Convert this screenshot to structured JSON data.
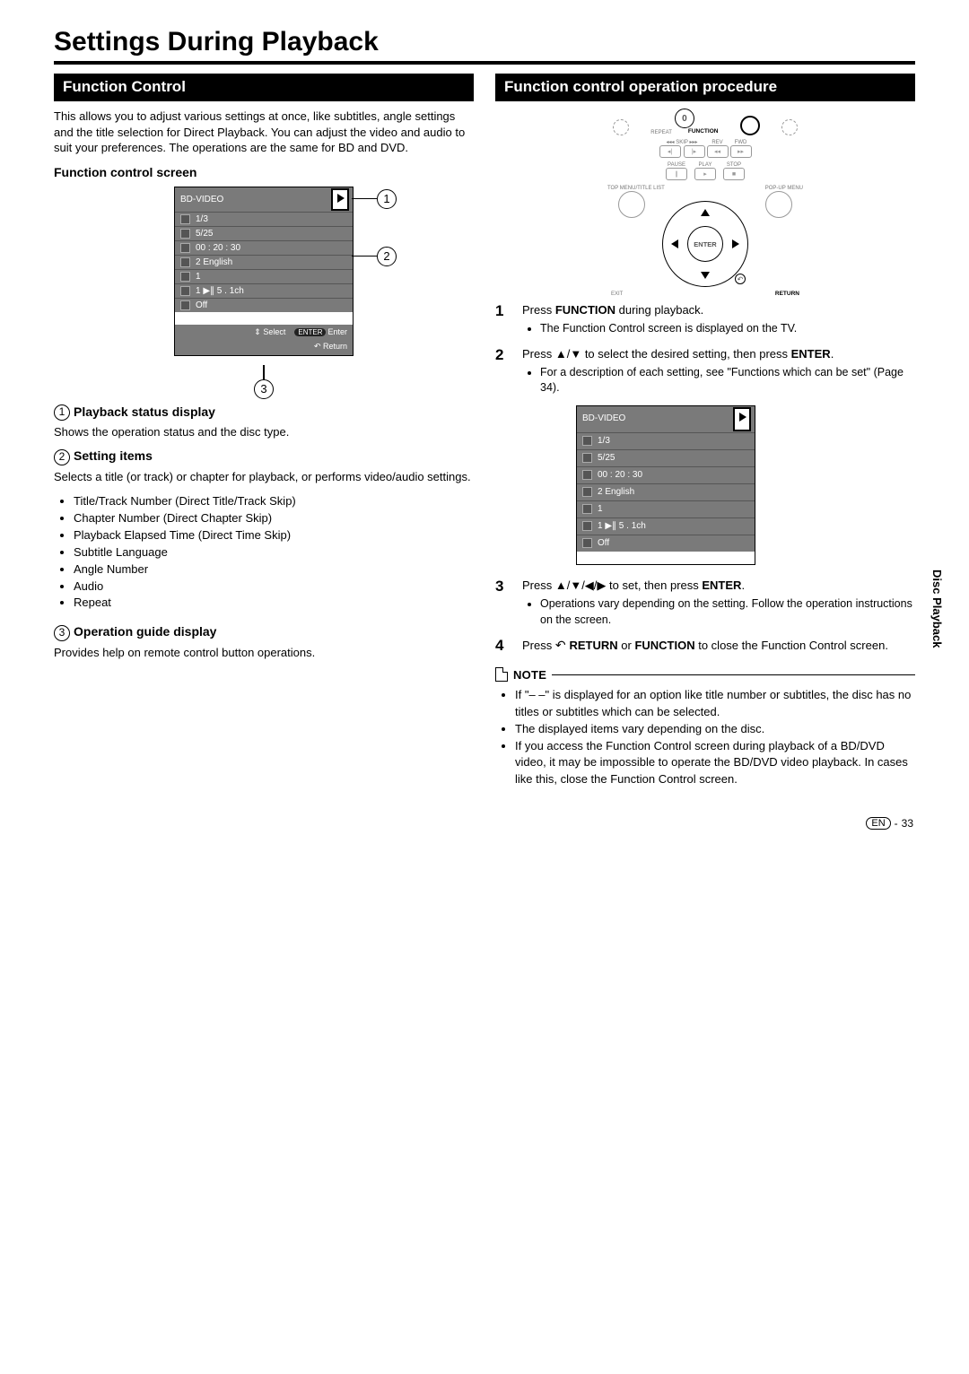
{
  "page": {
    "title": "Settings During Playback",
    "sideTab": "Disc Playback",
    "footerLang": "EN",
    "footerPage": "33"
  },
  "left": {
    "sectionTitle": "Function Control",
    "intro": "This allows you to adjust various settings at once, like subtitles, angle settings and the title selection for Direct Playback. You can adjust the video and audio to suit your preferences. The operations are the same for BD and DVD.",
    "screenLabel": "Function control screen",
    "screen": {
      "header": "BD-VIDEO",
      "rows": [
        "1/3",
        "5/25",
        "00 : 20 : 30",
        "2 English",
        "1",
        "1   ▶∥   5 . 1ch",
        "Off"
      ],
      "guideSelect": "Select",
      "guideEnterPill": "ENTER",
      "guideEnter": "Enter",
      "guideReturn": "Return"
    },
    "item1": {
      "num": "1",
      "title": "Playback status display",
      "text": "Shows the operation status and the disc type."
    },
    "item2": {
      "num": "2",
      "title": "Setting items",
      "text": "Selects a title (or track) or chapter for playback, or performs video/audio settings.",
      "bullets": [
        "Title/Track Number (Direct Title/Track Skip)",
        "Chapter Number (Direct Chapter Skip)",
        "Playback Elapsed Time (Direct Time Skip)",
        "Subtitle Language",
        "Angle Number",
        "Audio",
        "Repeat"
      ]
    },
    "item3": {
      "num": "3",
      "title": "Operation guide display",
      "text": "Provides help on remote control button operations."
    }
  },
  "right": {
    "sectionTitle": "Function control operation procedure",
    "remote": {
      "zero": "0",
      "repeat": "REPEAT",
      "function": "FUNCTION",
      "skip": "SKIP",
      "rev": "REV",
      "fwd": "FWD",
      "pause": "PAUSE",
      "play": "PLAY",
      "stop": "STOP",
      "topMenu": "TOP MENU/TITLE LIST",
      "popup": "POP-UP MENU",
      "enter": "ENTER",
      "exit": "EXIT",
      "return": "RETURN"
    },
    "steps": {
      "s1a": "Press ",
      "s1b": "FUNCTION",
      "s1c": " during playback.",
      "s1sub": "The Function Control screen is displayed on the TV.",
      "s2a": "Press ",
      "s2arrows": "▲/▼",
      "s2b": " to select the desired setting, then press ",
      "s2enter": "ENTER",
      "s2c": ".",
      "s2sub": "For a description of each setting, see \"Functions which can be set\" (Page 34).",
      "s3a": "Press ",
      "s3arrows": "▲/▼/◀/▶",
      "s3b": " to set, then press ",
      "s3enter": "ENTER",
      "s3c": ".",
      "s3sub": "Operations vary depending on the setting. Follow the operation instructions on the screen.",
      "s4a": "Press ",
      "s4ret": "RETURN",
      "s4b": " or ",
      "s4func": "FUNCTION",
      "s4c": " to close the Function Control screen."
    },
    "screen2": {
      "header": "BD-VIDEO",
      "rows": [
        "1/3",
        "5/25",
        "00 : 20 : 30",
        "2 English",
        "1",
        "1   ▶∥   5 . 1ch",
        "Off"
      ]
    },
    "note": {
      "label": "NOTE",
      "items": [
        "If \"– –\" is displayed for an option like title number or subtitles, the disc has no titles or subtitles which can be selected.",
        "The displayed items vary depending on the disc.",
        "If you access the Function Control screen during playback of a BD/DVD video, it may be impossible to operate the BD/DVD video playback. In cases like this, close the Function Control screen."
      ]
    }
  }
}
